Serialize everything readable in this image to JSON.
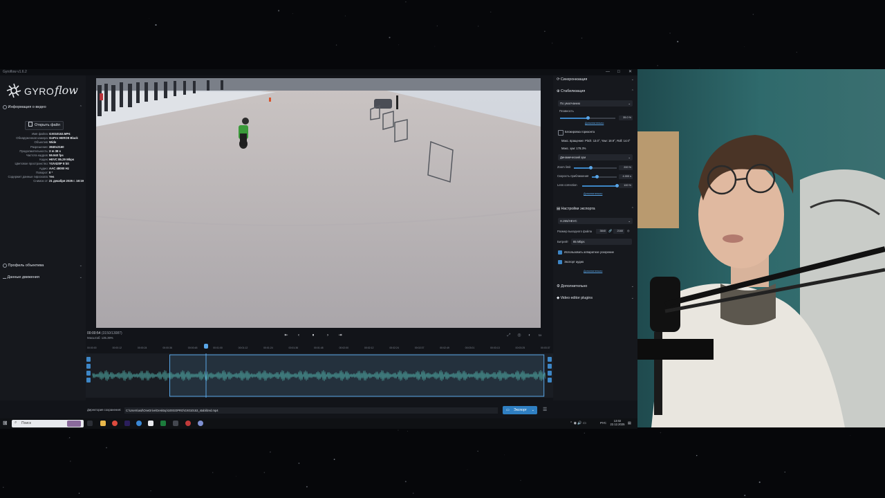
{
  "window": {
    "title": "Gyroflow v1.6.2",
    "controls": [
      "—",
      "□",
      "✕"
    ]
  },
  "brand": {
    "logo_left": "GYRO",
    "logo_right": "flow",
    "accent": "#2f7fc2"
  },
  "left_panel": {
    "video_info_title": "Информация о видео",
    "open_file_label": "Открыть файл",
    "info": [
      {
        "k": "Имя файла:",
        "v": "GX010153.MP4"
      },
      {
        "k": "Обнаруженная камера:",
        "v": "GoPro HERO8 Black"
      },
      {
        "k": "Объектив:",
        "v": "Wide"
      },
      {
        "k": "Разрешение:",
        "v": "3840x2160"
      },
      {
        "k": "Продолжительность:",
        "v": "3 m 38 s"
      },
      {
        "k": "Частота кадров:",
        "v": "59.940 fps"
      },
      {
        "k": "Кодек:",
        "v": "HEVC 85.29 Mbps"
      },
      {
        "k": "Цветовое пространство:",
        "v": "YUV420P 8 bit"
      },
      {
        "k": "Аудио:",
        "v": "AAC 48000 Hz"
      },
      {
        "k": "Поворот:",
        "v": "0 °"
      },
      {
        "k": "Содержит данные гироскопа:",
        "v": "Yes"
      },
      {
        "k": "Снимок от:",
        "v": "21 декабря 2025 г. 18:19"
      }
    ],
    "lens_profile_title": "Профиль объектива",
    "motion_data_title": "Данные движения"
  },
  "player": {
    "timecode": "00:00:54",
    "frame": "(3150/13087)",
    "zoom": "Масштаб: 135.39%",
    "buttons": [
      "⇤",
      "‹",
      "⏸",
      "›",
      "⇥"
    ],
    "right_controls": [
      "⤢",
      "◎",
      "◐",
      "1x"
    ],
    "ruler": [
      "00:00:00",
      "00:00:12",
      "00:00:24",
      "00:00:36",
      "00:00:48",
      "00:01:00",
      "00:01:12",
      "00:01:24",
      "00:01:36",
      "00:01:48",
      "00:02:00",
      "00:02:12",
      "00:02:24",
      "00:02:37",
      "00:02:49",
      "00:03:01",
      "00:03:13",
      "00:03:25",
      "00:03:37"
    ],
    "playhead_fraction": 0.25,
    "selection_start_fraction": 0.17,
    "selection_end_fraction": 0.995
  },
  "right_panel": {
    "sync_title": "Синхронизация",
    "stab_title": "Стабилизация",
    "stab_method": "По умолчанию",
    "smoothness_label": "Плавность",
    "smoothness_value": "35.0 %",
    "smoothness_fraction": 0.5,
    "more_link": "Дополнительно",
    "horizon_lock_label": "Блокировка горизонта",
    "max_angles": "Макс. вращение: Pitch: 13.0°, Yaw: 18.9°, Roll: 14.0°",
    "max_zoom": "Макс. зум: 178.3%",
    "zoom_method": "Динамический зум",
    "zoom_limit_label": "Zoom limit",
    "zoom_limit_value": "200 %",
    "zoom_limit_fraction": 0.4,
    "zoom_speed_label": "Скорость приближения",
    "zoom_speed_value": "4.000 s",
    "zoom_speed_fraction": 0.22,
    "lens_corr_label": "Lens correction",
    "lens_corr_value": "100 %",
    "lens_corr_fraction": 1.0,
    "more_link2": "Дополнительно",
    "export_title": "Настройки экспорта",
    "codec": "H.265/HEVC",
    "output_size_label": "Размер выходного файла",
    "out_w": "3840",
    "out_h": "2160",
    "bitrate_label": "Битрейт",
    "bitrate_value": "85 Mbps",
    "hw_accel_label": "Использовать аппаратное ускорение",
    "export_audio_label": "Экспорт аудио",
    "more_link3": "Дополнительно",
    "advanced_title": "Дополнительно",
    "plugins_title": "Video editor plugins"
  },
  "bottom": {
    "output_dir_label": "Директория сохранения:",
    "output_path": "C:\\Users\\asd\\OneDrive\\Desktop\\100GOPRO\\GX010153_stabilized.mp4",
    "export_label": "Экспорт"
  },
  "taskbar": {
    "search_placeholder": "Поиск",
    "lang": "РУС",
    "time": "13:02",
    "date": "22.12.2025"
  }
}
